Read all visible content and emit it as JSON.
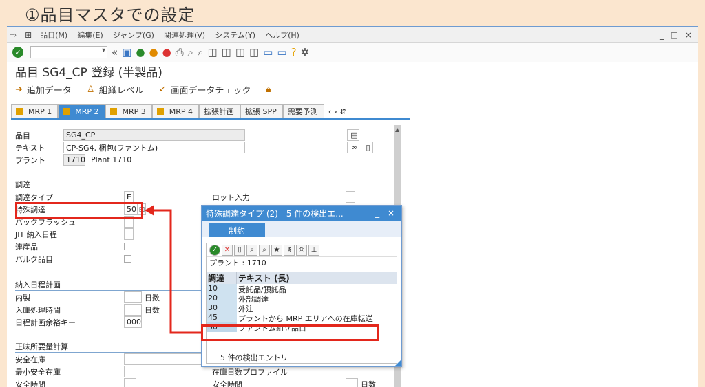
{
  "caption": "①品目マスタでの設定",
  "menu": {
    "items": [
      "品目(M)",
      "編集(E)",
      "ジャンプ(G)",
      "関連処理(V)",
      "システム(Y)",
      "ヘルプ(H)"
    ],
    "window_controls": "_ □ ×"
  },
  "title": "品目 SG4_CP 登録 (半製品)",
  "app_toolbar": {
    "additional_data": "追加データ",
    "org_levels": "組織レベル",
    "screen_check": "画面データチェック"
  },
  "tabs": [
    "MRP 1",
    "MRP 2",
    "MRP 3",
    "MRP 4",
    "拡張計画",
    "拡張 SPP",
    "需要予測"
  ],
  "header": {
    "material_label": "品目",
    "material_value": "SG4_CP",
    "text_label": "テキスト",
    "text_value": "CP-SG4, 梱包(ファントム)",
    "plant_label": "プラント",
    "plant_value": "1710",
    "plant_text": "Plant 1710"
  },
  "procurement": {
    "section": "調達",
    "proc_type_label": "調達タイプ",
    "proc_type_value": "E",
    "special_proc_label": "特殊調達",
    "special_proc_value": "50",
    "backflush_label": "バックフラッシュ",
    "jit_label": "JIT 納入日程",
    "coproduct_label": "連産品",
    "bulk_label": "バルク品目",
    "lot_entry_label": "ロット入力"
  },
  "scheduling": {
    "section": "納入日程計画",
    "inhouse_label": "内製",
    "inhouse_unit": "日数",
    "gr_time_label": "入庫処理時間",
    "gr_time_unit": "日数",
    "margin_key_label": "日程計画余裕キー",
    "margin_key_value": "000"
  },
  "net_req": {
    "section": "正味所要量計算",
    "safety_stock_label": "安全在庫",
    "min_safety_label": "最小安全在庫",
    "safety_time_label": "安全時間",
    "coverage_profile_label": "在庫日数プロファイル",
    "safety_time_label2": "安全時間",
    "days_unit": "日数"
  },
  "popup": {
    "title": "特殊調達タイプ (2)　5 件の検出エ...",
    "tab": "制約",
    "plant_line": "プラント : 1710",
    "col_proc": "調達",
    "col_text": "テキスト (長)",
    "rows": [
      {
        "code": "10",
        "text": "受託品/預託品"
      },
      {
        "code": "20",
        "text": "外部調達"
      },
      {
        "code": "30",
        "text": "外注"
      },
      {
        "code": "45",
        "text": "プラントから MRP エリアへの在庫転送"
      },
      {
        "code": "50",
        "text": "ファントム組立品目"
      }
    ],
    "footer": "5 件の検出エントリ"
  },
  "colors": {
    "accent": "#3f8ad1",
    "highlight": "#e3271c",
    "background": "#fbe6cf"
  }
}
